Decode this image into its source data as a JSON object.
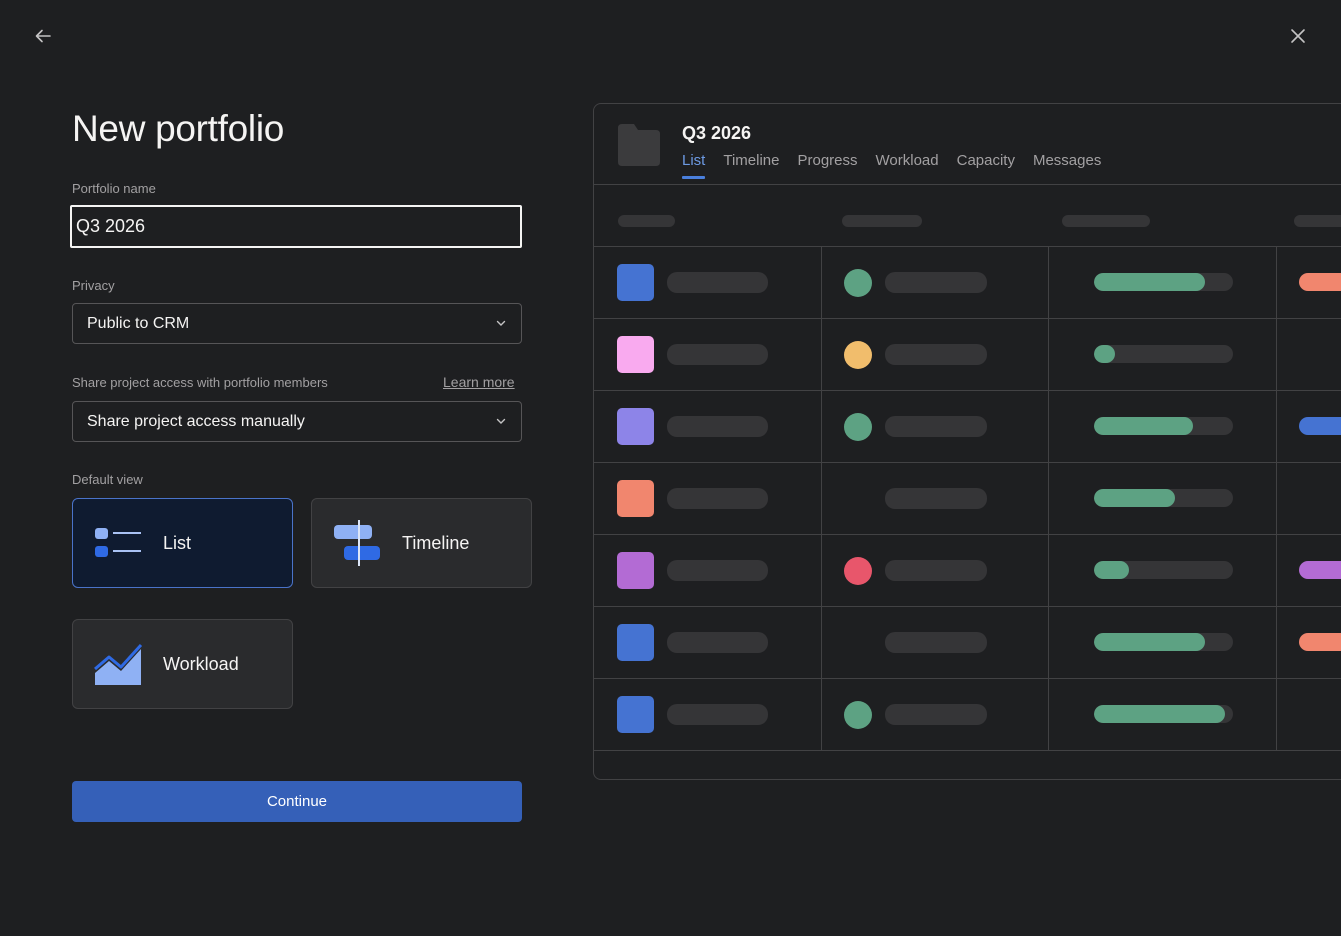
{
  "page": {
    "back_icon": "arrow-left-icon",
    "close_icon": "close-icon",
    "title": "New portfolio"
  },
  "form": {
    "name_label": "Portfolio name",
    "name_value": "Q3 2026",
    "privacy_label": "Privacy",
    "privacy_value": "Public to CRM",
    "share_label": "Share project access with portfolio members",
    "learn_more": "Learn more",
    "share_value": "Share project access manually",
    "default_view_label": "Default view",
    "views": [
      {
        "label": "List",
        "icon": "list-view-icon",
        "selected": true
      },
      {
        "label": "Timeline",
        "icon": "timeline-view-icon",
        "selected": false
      },
      {
        "label": "Workload",
        "icon": "workload-view-icon",
        "selected": false
      }
    ],
    "continue_label": "Continue"
  },
  "preview": {
    "icon": "folder-icon",
    "title": "Q3 2026",
    "tabs": [
      "List",
      "Timeline",
      "Progress",
      "Workload",
      "Capacity",
      "Messages"
    ],
    "active_tab": "List",
    "rows": [
      {
        "color": "#4573d2",
        "status": "#5da283",
        "progress": 0.8,
        "tail": "#f1866e"
      },
      {
        "color": "#f9aaef",
        "status": "#f1bd6c",
        "progress": 0.15,
        "tail": null
      },
      {
        "color": "#8d84e8",
        "status": "#5da283",
        "progress": 0.71,
        "tail": "#4573d2"
      },
      {
        "color": "#f1866e",
        "status": null,
        "progress": 0.58,
        "tail": null
      },
      {
        "color": "#b36bd4",
        "status": "#e8566b",
        "progress": 0.25,
        "tail": "#b36bd4"
      },
      {
        "color": "#4573d2",
        "status": null,
        "progress": 0.8,
        "tail": "#f1866e"
      },
      {
        "color": "#4573d2",
        "status": "#5da283",
        "progress": 0.94,
        "tail": null
      }
    ]
  }
}
